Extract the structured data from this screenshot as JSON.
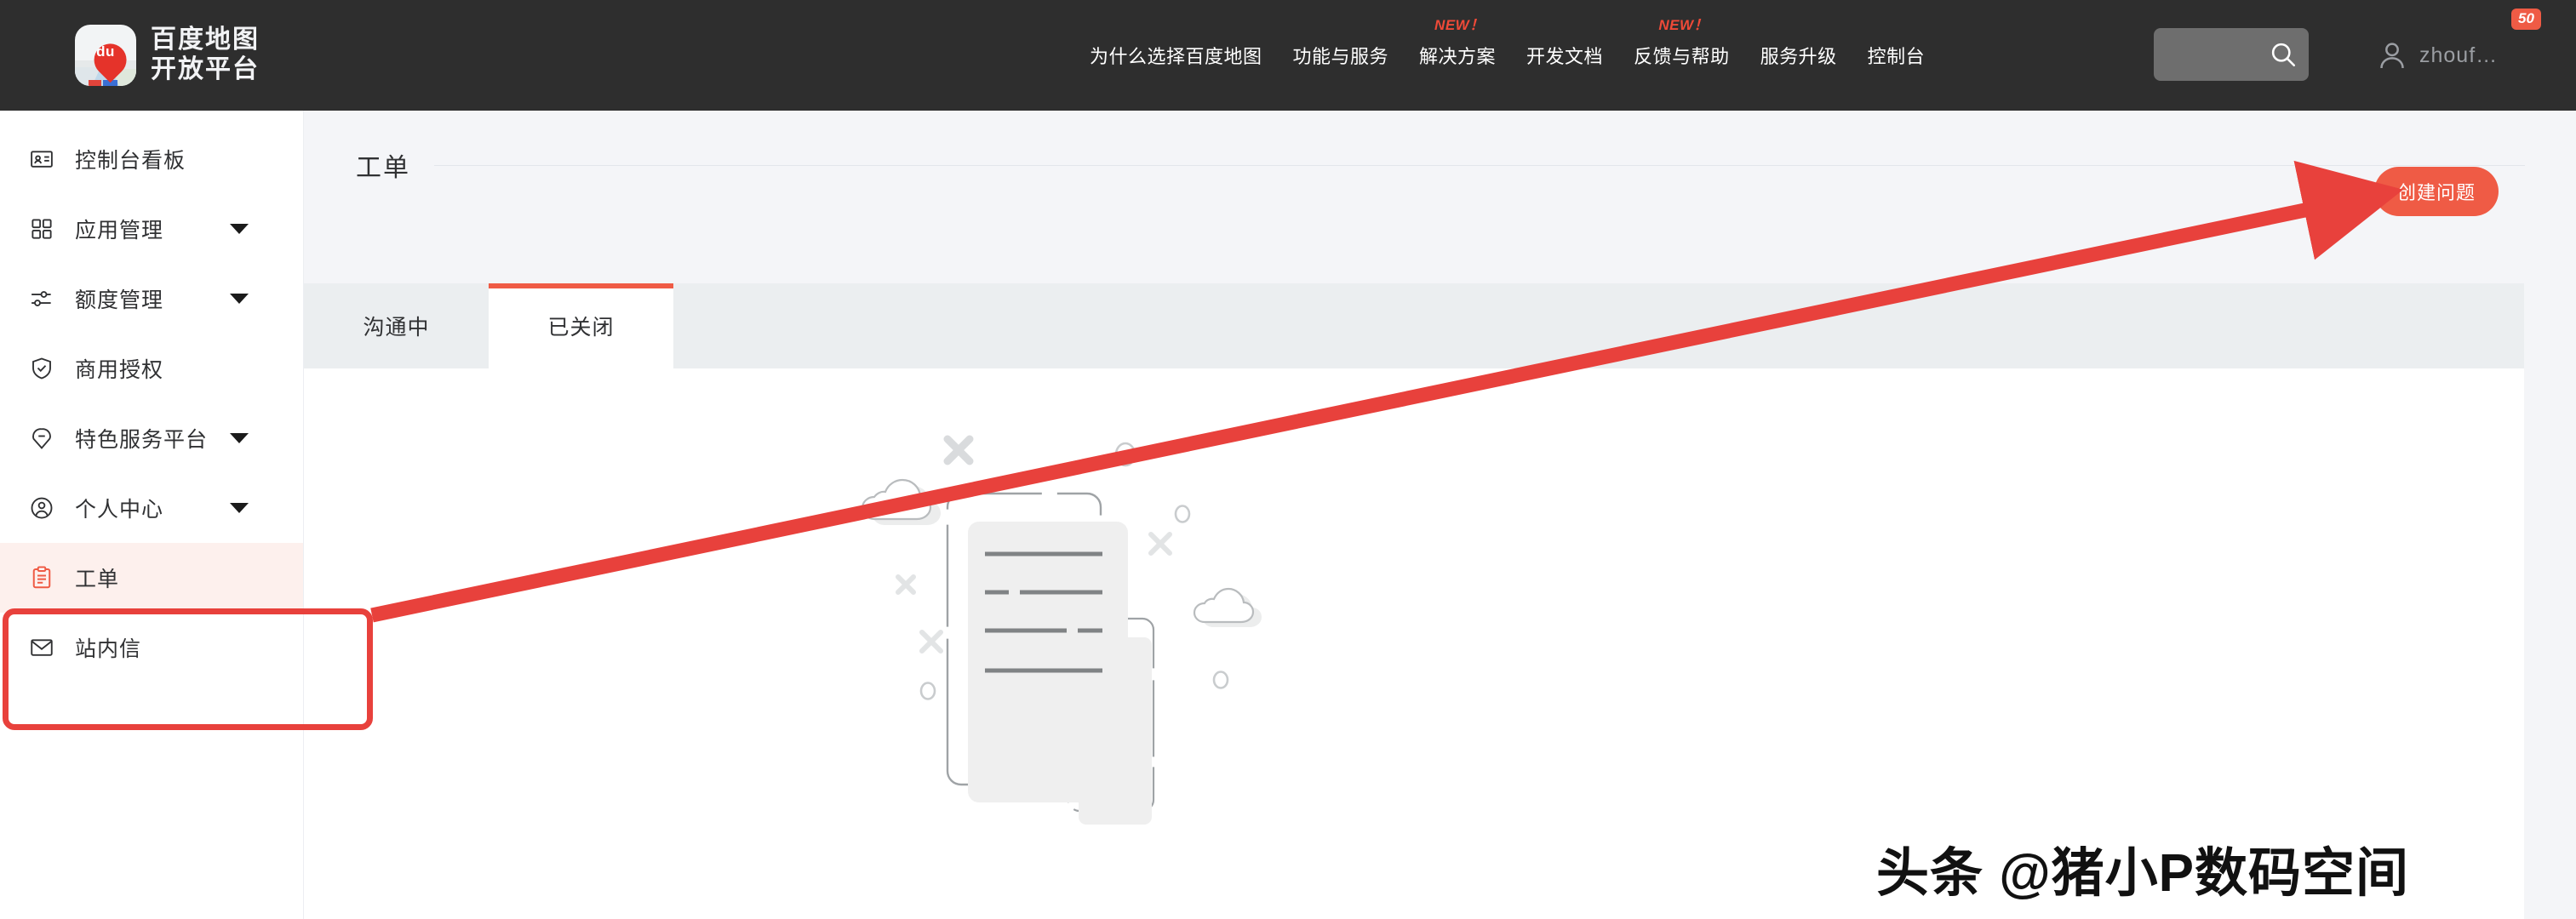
{
  "header": {
    "brand": {
      "line1": "百度地图",
      "line2": "开放平台",
      "pin_text": "du"
    },
    "nav": [
      {
        "label": "为什么选择百度地图",
        "badge": ""
      },
      {
        "label": "功能与服务",
        "badge": ""
      },
      {
        "label": "解决方案",
        "badge": "NEW！"
      },
      {
        "label": "开发文档",
        "badge": ""
      },
      {
        "label": "反馈与帮助",
        "badge": "NEW！"
      },
      {
        "label": "服务升级",
        "badge": ""
      },
      {
        "label": "控制台",
        "badge": ""
      }
    ],
    "search": {
      "value": "",
      "placeholder": ""
    },
    "user": {
      "name": "zhouf…",
      "badge": "50"
    }
  },
  "sidebar": {
    "items": [
      {
        "label": "控制台看板",
        "icon": "id-card-icon",
        "caret": false,
        "active": false
      },
      {
        "label": "应用管理",
        "icon": "grid-icon",
        "caret": true,
        "active": false
      },
      {
        "label": "额度管理",
        "icon": "sliders-icon",
        "caret": true,
        "active": false
      },
      {
        "label": "商用授权",
        "icon": "shield-check-icon",
        "caret": false,
        "active": false
      },
      {
        "label": "特色服务平台",
        "icon": "map-pin-icon",
        "caret": true,
        "active": false
      },
      {
        "label": "个人中心",
        "icon": "user-circle-icon",
        "caret": true,
        "active": false
      },
      {
        "label": "工单",
        "icon": "clipboard-icon",
        "caret": false,
        "active": true
      },
      {
        "label": "站内信",
        "icon": "envelope-icon",
        "caret": false,
        "active": false
      }
    ]
  },
  "main": {
    "page_title": "工单",
    "create_button": "创建问题",
    "tabs": [
      {
        "label": "沟通中",
        "active": false
      },
      {
        "label": "已关闭",
        "active": true
      }
    ],
    "empty_state": ""
  },
  "annotations": {
    "watermark": "头条 @猪小P数码空间",
    "highlight_color": "#e8413c",
    "arrow_color": "#e8413c"
  },
  "colors": {
    "accent": "#ef5b45",
    "header_bg": "#2e2e2e",
    "page_bg": "#f4f5f8",
    "tab_bg": "#ebeef0",
    "new_label": "#ef4a38"
  }
}
